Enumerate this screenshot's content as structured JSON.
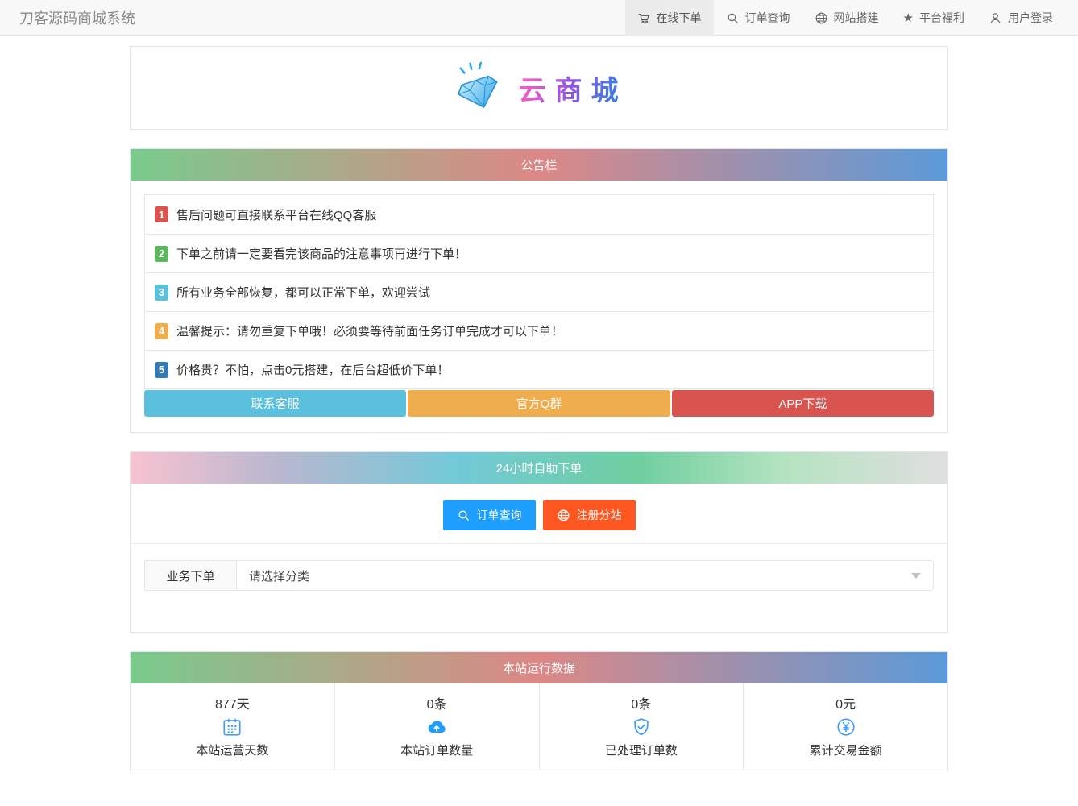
{
  "navbar": {
    "brand": "刀客源码商城系统",
    "items": [
      {
        "label": "在线下单",
        "icon": "cart-icon",
        "active": true
      },
      {
        "label": "订单查询",
        "icon": "search-icon",
        "active": false
      },
      {
        "label": "网站搭建",
        "icon": "globe-icon",
        "active": false
      },
      {
        "label": "平台福利",
        "icon": "star-icon",
        "active": false
      },
      {
        "label": "用户登录",
        "icon": "user-icon",
        "active": false
      }
    ]
  },
  "logo": {
    "text": "云商城",
    "icon": "diamond-icon"
  },
  "notice": {
    "title": "公告栏",
    "items": [
      {
        "num": "1",
        "text": "售后问题可直接联系平台在线QQ客服",
        "color": "#d9534f"
      },
      {
        "num": "2",
        "text": "下单之前请一定要看完该商品的注意事项再进行下单！",
        "color": "#5cb85c"
      },
      {
        "num": "3",
        "text": "所有业务全部恢复，都可以正常下单，欢迎尝试",
        "color": "#5bc0de"
      },
      {
        "num": "4",
        "text": "温馨提示：请勿重复下单哦！必须要等待前面任务订单完成才可以下单！",
        "color": "#f0ad4e"
      },
      {
        "num": "5",
        "text": "价格贵？不怕，点击0元搭建，在后台超低价下单！",
        "color": "#337ab7"
      }
    ],
    "buttons": [
      {
        "label": "联系客服",
        "color": "#5bc0de"
      },
      {
        "label": "官方Q群",
        "color": "#f0ad4e"
      },
      {
        "label": "APP下载",
        "color": "#d9534f"
      }
    ]
  },
  "order": {
    "title": "24小时自助下单",
    "buttons": [
      {
        "label": "订单查询",
        "color": "#1E9FFF",
        "icon": "search-icon"
      },
      {
        "label": "注册分站",
        "color": "#FF5722",
        "icon": "globe-icon"
      }
    ],
    "form": {
      "label": "业务下单",
      "placeholder": "请选择分类"
    }
  },
  "stats": {
    "title": "本站运行数据",
    "icon_color": "#409EFF",
    "items": [
      {
        "value": "877天",
        "label": "本站运营天数",
        "icon": "calendar-icon"
      },
      {
        "value": "0条",
        "label": "本站订单数量",
        "icon": "cloud-upload-icon"
      },
      {
        "value": "0条",
        "label": "已处理订单数",
        "icon": "shield-check-icon"
      },
      {
        "value": "0元",
        "label": "累计交易金额",
        "icon": "yen-circle-icon"
      }
    ]
  }
}
